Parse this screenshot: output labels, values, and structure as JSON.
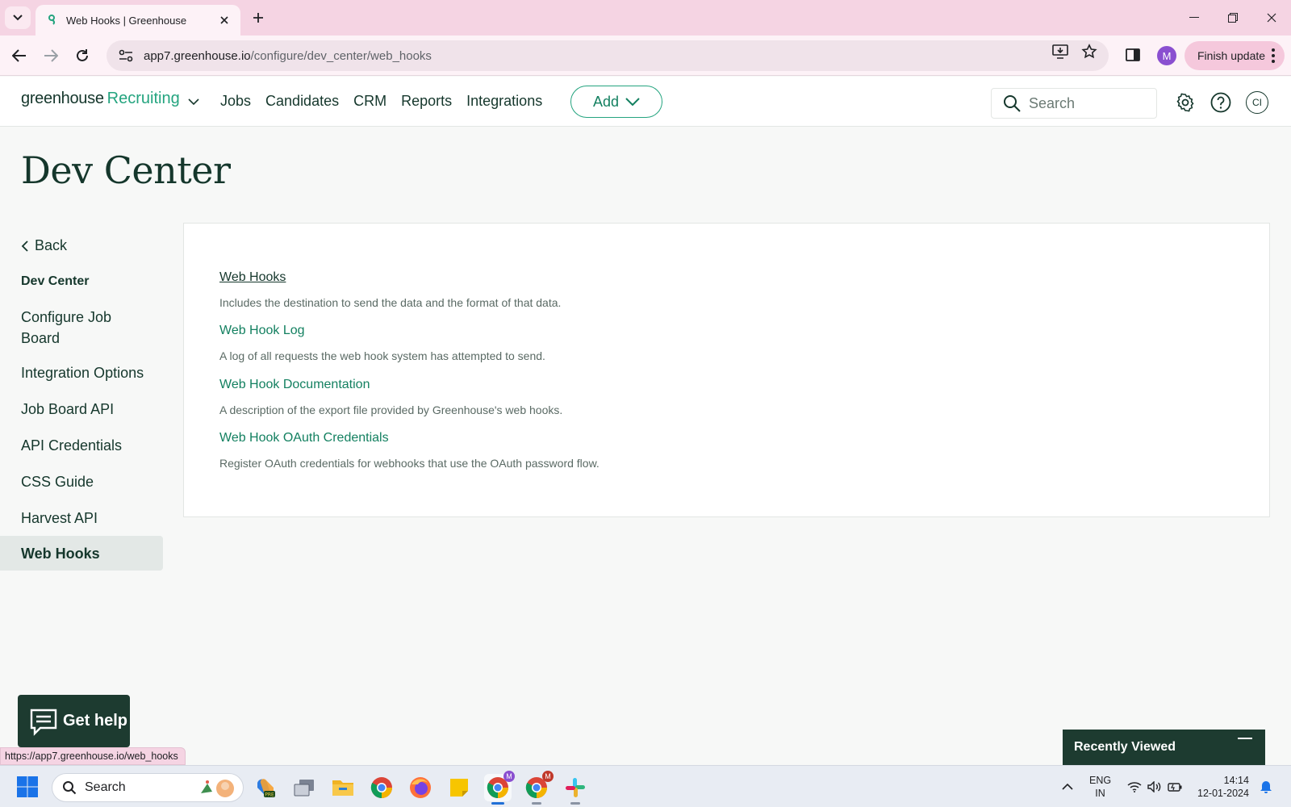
{
  "browser": {
    "tab_title": "Web Hooks | Greenhouse",
    "url_host": "app7.greenhouse.io",
    "url_path": "/configure/dev_center/web_hooks",
    "profile_initial": "M",
    "finish_update_label": "Finish update",
    "status_url": "https://app7.greenhouse.io/web_hooks"
  },
  "header": {
    "logo_text": "greenhouse",
    "product_text": "Recruiting",
    "nav": [
      "Jobs",
      "Candidates",
      "CRM",
      "Reports",
      "Integrations"
    ],
    "add_label": "Add",
    "search_placeholder": "Search",
    "avatar_initials": "CI"
  },
  "page": {
    "title": "Dev Center"
  },
  "sidebar": {
    "back_label": "Back",
    "heading": "Dev Center",
    "items": [
      {
        "label": "Configure Job\nBoard"
      },
      {
        "label": "Integration Options"
      },
      {
        "label": "Job Board API"
      },
      {
        "label": "API Credentials"
      },
      {
        "label": "CSS Guide"
      },
      {
        "label": "Harvest API"
      },
      {
        "label": "Web Hooks",
        "active": true
      }
    ]
  },
  "content": {
    "entries": [
      {
        "title": "Web Hooks",
        "desc": "Includes the destination to send the data and the format of that data.",
        "current": true
      },
      {
        "title": "Web Hook Log",
        "desc": "A log of all requests the web hook system has attempted to send."
      },
      {
        "title": "Web Hook Documentation",
        "desc": "A description of the export file provided by Greenhouse's web hooks."
      },
      {
        "title": "Web Hook OAuth Credentials",
        "desc": "Register OAuth credentials for webhooks that use the OAuth password flow."
      }
    ]
  },
  "widgets": {
    "get_help_label": "Get help",
    "recently_viewed_label": "Recently Viewed"
  },
  "taskbar": {
    "search_label": "Search",
    "lang_line1": "ENG",
    "lang_line2": "IN",
    "time": "14:14",
    "date": "12-01-2024",
    "chrome_badge_1": "M",
    "chrome_badge_2": "M"
  },
  "colors": {
    "brand_green": "#24a47f",
    "brand_dark": "#15372c",
    "link_green": "#138060"
  }
}
